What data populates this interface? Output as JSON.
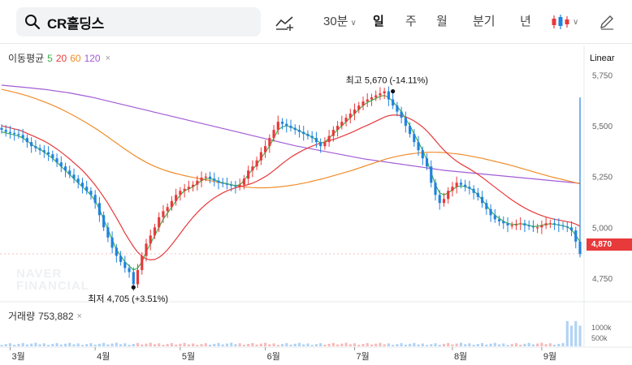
{
  "toolbar": {
    "search_value": "CR홀딩스",
    "interval_label": "30분",
    "periods": [
      "일",
      "주",
      "월",
      "분기",
      "년"
    ],
    "active_period": "일"
  },
  "watermark": {
    "line1": "NAVER",
    "line2": "FINANCIAL"
  },
  "ma_legend": {
    "title": "이동평균",
    "periods": [
      {
        "label": "5",
        "color": "#3eb04a"
      },
      {
        "label": "20",
        "color": "#e8393b"
      },
      {
        "label": "60",
        "color": "#f08c2a"
      },
      {
        "label": "120",
        "color": "#a35cd6"
      }
    ]
  },
  "volume_legend": {
    "label": "거래량",
    "value": "753,882"
  },
  "colors": {
    "up": "#e8393b",
    "down": "#1f82e0",
    "ma5": "#3eb04a",
    "ma20": "#e8393b",
    "ma60": "#f08c2a",
    "ma120": "#a35cd6"
  },
  "chart_data": {
    "type": "candlestick",
    "scale": "Linear",
    "ylim": [
      4650,
      5800
    ],
    "y_ticks": [
      {
        "value": 5750,
        "label": "5,750"
      },
      {
        "value": 5500,
        "label": "5,500"
      },
      {
        "value": 5250,
        "label": "5,250"
      },
      {
        "value": 5000,
        "label": "5,000"
      },
      {
        "value": 4750,
        "label": "4,750"
      }
    ],
    "x_months": [
      {
        "label": "3월",
        "index": 2
      },
      {
        "label": "4월",
        "index": 22
      },
      {
        "label": "5월",
        "index": 42
      },
      {
        "label": "6월",
        "index": 62
      },
      {
        "label": "7월",
        "index": 83
      },
      {
        "label": "8월",
        "index": 106
      },
      {
        "label": "9월",
        "index": 127
      }
    ],
    "current_price": {
      "value": 4870,
      "label": "4,870"
    },
    "annotations": {
      "high": {
        "index": 92,
        "value": 5670,
        "prefix": "최고",
        "value_label": "5,670",
        "change": "(-14.11%)"
      },
      "low": {
        "index": 31,
        "value": 4705,
        "prefix": "최저",
        "value_label": "4,705",
        "change": "(+3.51%)"
      }
    },
    "close": [
      5480,
      5470,
      5465,
      5460,
      5455,
      5440,
      5420,
      5400,
      5390,
      5380,
      5370,
      5360,
      5340,
      5320,
      5300,
      5280,
      5260,
      5240,
      5220,
      5200,
      5180,
      5160,
      5120,
      5060,
      5000,
      4950,
      4900,
      4860,
      4830,
      4800,
      4780,
      4720,
      4790,
      4860,
      4920,
      4960,
      5000,
      5050,
      5080,
      5100,
      5130,
      5160,
      5180,
      5190,
      5200,
      5210,
      5230,
      5245,
      5250,
      5240,
      5230,
      5220,
      5215,
      5210,
      5205,
      5200,
      5210,
      5240,
      5280,
      5300,
      5330,
      5370,
      5400,
      5440,
      5480,
      5520,
      5510,
      5500,
      5490,
      5480,
      5470,
      5460,
      5450,
      5440,
      5420,
      5400,
      5420,
      5450,
      5480,
      5500,
      5520,
      5540,
      5560,
      5580,
      5600,
      5620,
      5630,
      5640,
      5650,
      5660,
      5670,
      5630,
      5600,
      5570,
      5540,
      5500,
      5460,
      5420,
      5380,
      5340,
      5300,
      5220,
      5160,
      5120,
      5140,
      5180,
      5200,
      5220,
      5210,
      5200,
      5190,
      5170,
      5150,
      5120,
      5090,
      5060,
      5040,
      5030,
      5020,
      5010,
      5010,
      5015,
      5020,
      5010,
      5005,
      5000,
      5000,
      5010,
      5020,
      5020,
      5015,
      5010,
      5005,
      5000,
      4985,
      4930,
      4870
    ],
    "ma5": [
      5470,
      5465,
      5460,
      5455,
      5450,
      5440,
      5425,
      5410,
      5395,
      5385,
      5370,
      5355,
      5340,
      5320,
      5300,
      5280,
      5260,
      5240,
      5220,
      5200,
      5180,
      5160,
      5130,
      5090,
      5040,
      4990,
      4940,
      4890,
      4860,
      4830,
      4810,
      4790,
      4800,
      4830,
      4880,
      4920,
      4960,
      5000,
      5040,
      5070,
      5100,
      5130,
      5160,
      5180,
      5190,
      5200,
      5215,
      5230,
      5240,
      5240,
      5235,
      5225,
      5220,
      5215,
      5210,
      5205,
      5210,
      5230,
      5260,
      5285,
      5310,
      5340,
      5370,
      5400,
      5440,
      5480,
      5495,
      5500,
      5495,
      5485,
      5475,
      5465,
      5455,
      5445,
      5430,
      5415,
      5420,
      5440,
      5460,
      5480,
      5500,
      5520,
      5540,
      5560,
      5580,
      5600,
      5615,
      5625,
      5635,
      5645,
      5650,
      5640,
      5620,
      5595,
      5570,
      5535,
      5500,
      5460,
      5420,
      5380,
      5330,
      5270,
      5210,
      5170,
      5160,
      5170,
      5185,
      5200,
      5205,
      5200,
      5195,
      5180,
      5160,
      5135,
      5110,
      5080,
      5060,
      5045,
      5030,
      5020,
      5015,
      5015,
      5018,
      5015,
      5010,
      5005,
      5005,
      5010,
      5015,
      5018,
      5015,
      5012,
      5008,
      5002,
      4990,
      4960,
      4930
    ],
    "ma20": [
      5500,
      5495,
      5490,
      5485,
      5480,
      5472,
      5463,
      5454,
      5445,
      5435,
      5425,
      5413,
      5400,
      5386,
      5370,
      5354,
      5337,
      5318,
      5300,
      5280,
      5258,
      5234,
      5208,
      5180,
      5150,
      5118,
      5083,
      5047,
      5010,
      4972,
      4938,
      4905,
      4878,
      4858,
      4845,
      4840,
      4842,
      4852,
      4868,
      4890,
      4915,
      4942,
      4970,
      4998,
      5025,
      5050,
      5073,
      5094,
      5113,
      5130,
      5145,
      5158,
      5170,
      5180,
      5188,
      5195,
      5200,
      5205,
      5211,
      5218,
      5227,
      5238,
      5250,
      5264,
      5280,
      5297,
      5314,
      5330,
      5345,
      5358,
      5370,
      5381,
      5391,
      5400,
      5408,
      5415,
      5421,
      5427,
      5433,
      5440,
      5448,
      5456,
      5465,
      5474,
      5484,
      5494,
      5503,
      5513,
      5523,
      5533,
      5543,
      5550,
      5553,
      5553,
      5550,
      5544,
      5535,
      5524,
      5510,
      5494,
      5475,
      5452,
      5428,
      5403,
      5380,
      5360,
      5342,
      5326,
      5312,
      5300,
      5288,
      5275,
      5261,
      5246,
      5230,
      5214,
      5198,
      5182,
      5166,
      5150,
      5135,
      5121,
      5108,
      5096,
      5085,
      5075,
      5066,
      5058,
      5051,
      5045,
      5040,
      5036,
      5032,
      5028,
      5024,
      5016,
      5006
    ],
    "ma60": [
      5680,
      5675,
      5670,
      5665,
      5660,
      5654,
      5648,
      5641,
      5634,
      5626,
      5618,
      5610,
      5601,
      5592,
      5582,
      5572,
      5561,
      5550,
      5538,
      5526,
      5514,
      5501,
      5488,
      5474,
      5460,
      5445,
      5430,
      5415,
      5400,
      5385,
      5371,
      5357,
      5344,
      5332,
      5320,
      5310,
      5300,
      5292,
      5284,
      5277,
      5271,
      5265,
      5260,
      5255,
      5250,
      5246,
      5242,
      5238,
      5234,
      5230,
      5226,
      5222,
      5218,
      5214,
      5210,
      5206,
      5203,
      5200,
      5198,
      5196,
      5195,
      5195,
      5195,
      5196,
      5197,
      5199,
      5201,
      5204,
      5207,
      5210,
      5214,
      5218,
      5222,
      5227,
      5232,
      5237,
      5242,
      5248,
      5254,
      5260,
      5266,
      5272,
      5278,
      5285,
      5292,
      5299,
      5306,
      5313,
      5320,
      5327,
      5334,
      5340,
      5345,
      5350,
      5354,
      5358,
      5361,
      5364,
      5366,
      5368,
      5369,
      5370,
      5370,
      5369,
      5368,
      5366,
      5364,
      5362,
      5359,
      5356,
      5352,
      5348,
      5344,
      5340,
      5335,
      5330,
      5325,
      5320,
      5315,
      5310,
      5304,
      5298,
      5292,
      5286,
      5280,
      5274,
      5268,
      5262,
      5256,
      5250,
      5245,
      5240,
      5235,
      5230,
      5225,
      5220,
      5215
    ],
    "ma120": [
      5700,
      5698,
      5696,
      5694,
      5692,
      5690,
      5688,
      5686,
      5684,
      5682,
      5680,
      5677,
      5674,
      5671,
      5668,
      5665,
      5662,
      5658,
      5654,
      5650,
      5646,
      5642,
      5637,
      5632,
      5627,
      5622,
      5617,
      5612,
      5607,
      5602,
      5597,
      5592,
      5587,
      5582,
      5577,
      5572,
      5567,
      5562,
      5557,
      5552,
      5547,
      5542,
      5537,
      5532,
      5527,
      5522,
      5517,
      5512,
      5507,
      5502,
      5497,
      5492,
      5487,
      5482,
      5477,
      5472,
      5467,
      5462,
      5457,
      5452,
      5447,
      5442,
      5437,
      5432,
      5427,
      5422,
      5417,
      5412,
      5407,
      5402,
      5398,
      5394,
      5390,
      5386,
      5382,
      5378,
      5374,
      5370,
      5366,
      5362,
      5358,
      5354,
      5350,
      5346,
      5342,
      5338,
      5335,
      5332,
      5329,
      5326,
      5323,
      5320,
      5317,
      5314,
      5311,
      5308,
      5305,
      5302,
      5299,
      5296,
      5293,
      5290,
      5287,
      5284,
      5281,
      5279,
      5277,
      5275,
      5273,
      5271,
      5269,
      5267,
      5265,
      5263,
      5261,
      5259,
      5257,
      5255,
      5253,
      5251,
      5249,
      5247,
      5245,
      5243,
      5241,
      5239,
      5237,
      5235,
      5233,
      5231,
      5229,
      5227,
      5225,
      5223,
      5221,
      5219,
      5217
    ]
  }
}
